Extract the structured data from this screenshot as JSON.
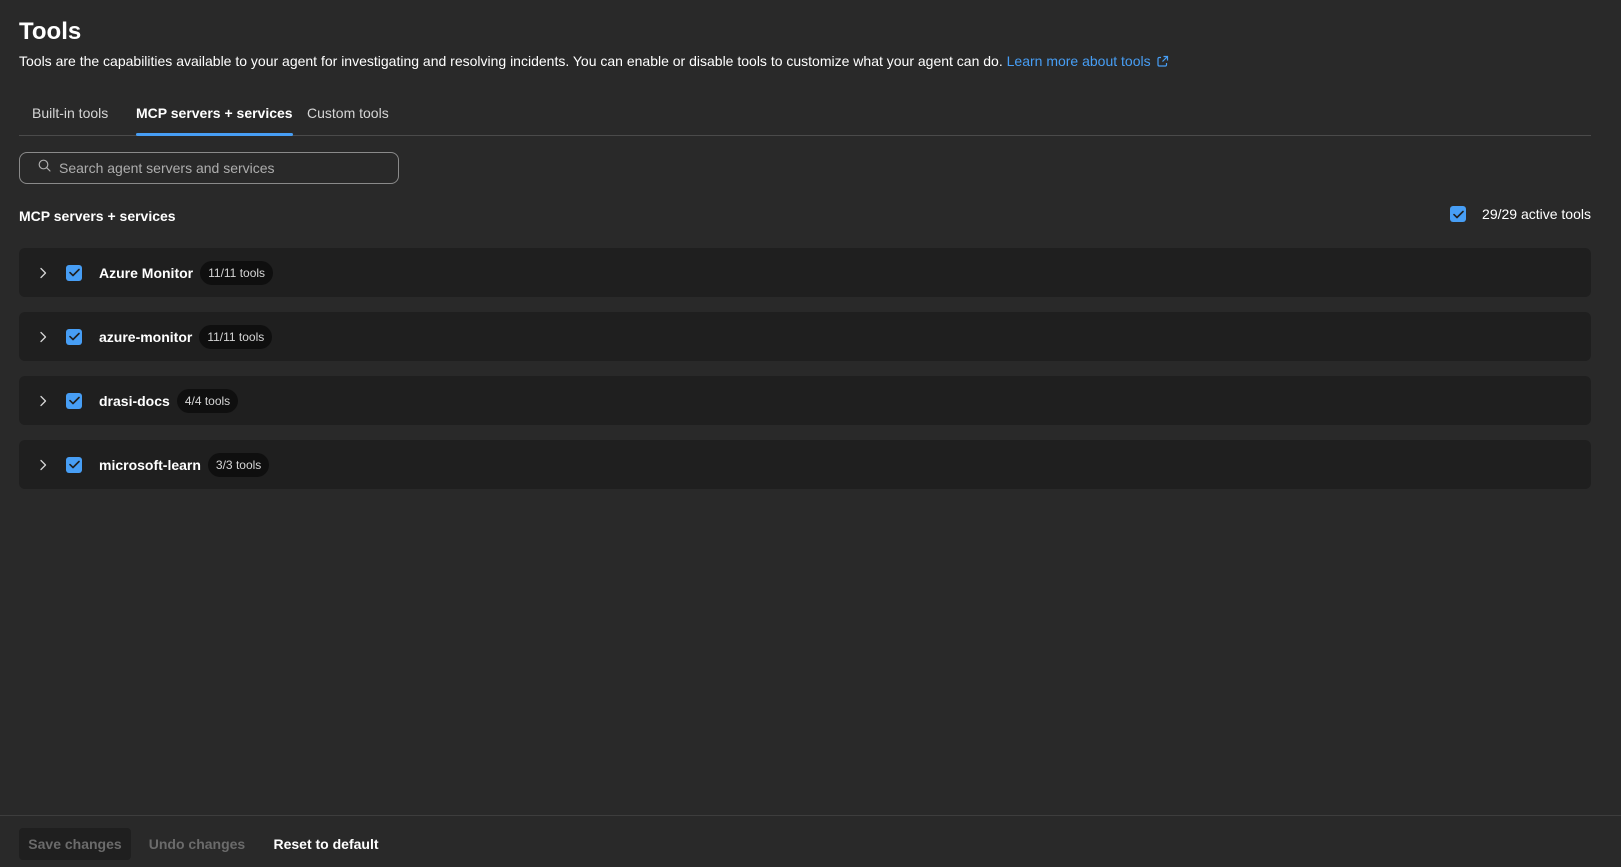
{
  "header": {
    "title": "Tools",
    "description": "Tools are the capabilities available to your agent for investigating and resolving incidents. You can enable or disable tools to customize what your agent can do.",
    "learn_more_link": "Learn more about tools"
  },
  "tabs": [
    {
      "label": "Built-in tools",
      "active": false
    },
    {
      "label": "MCP servers + services",
      "active": true
    },
    {
      "label": "Custom tools",
      "active": false
    }
  ],
  "search": {
    "placeholder": "Search agent servers and services",
    "value": ""
  },
  "section": {
    "title": "MCP servers + services",
    "active_tools_label": "29/29 active tools",
    "all_checked": true
  },
  "servers": [
    {
      "name": "Azure Monitor",
      "badge": "11/11 tools",
      "checked": true,
      "expanded": false
    },
    {
      "name": "azure-monitor",
      "badge": "11/11 tools",
      "checked": true,
      "expanded": false
    },
    {
      "name": "drasi-docs",
      "badge": "4/4 tools",
      "checked": true,
      "expanded": false
    },
    {
      "name": "microsoft-learn",
      "badge": "3/3 tools",
      "checked": true,
      "expanded": false
    }
  ],
  "footer": {
    "save_label": "Save changes",
    "undo_label": "Undo changes",
    "reset_label": "Reset to default"
  },
  "colors": {
    "accent": "#479ef5",
    "background": "#292929",
    "row_background": "#1f1f1f"
  },
  "icons": [
    "search-icon",
    "external-link-icon",
    "chevron-right-icon",
    "checkmark-icon"
  ]
}
